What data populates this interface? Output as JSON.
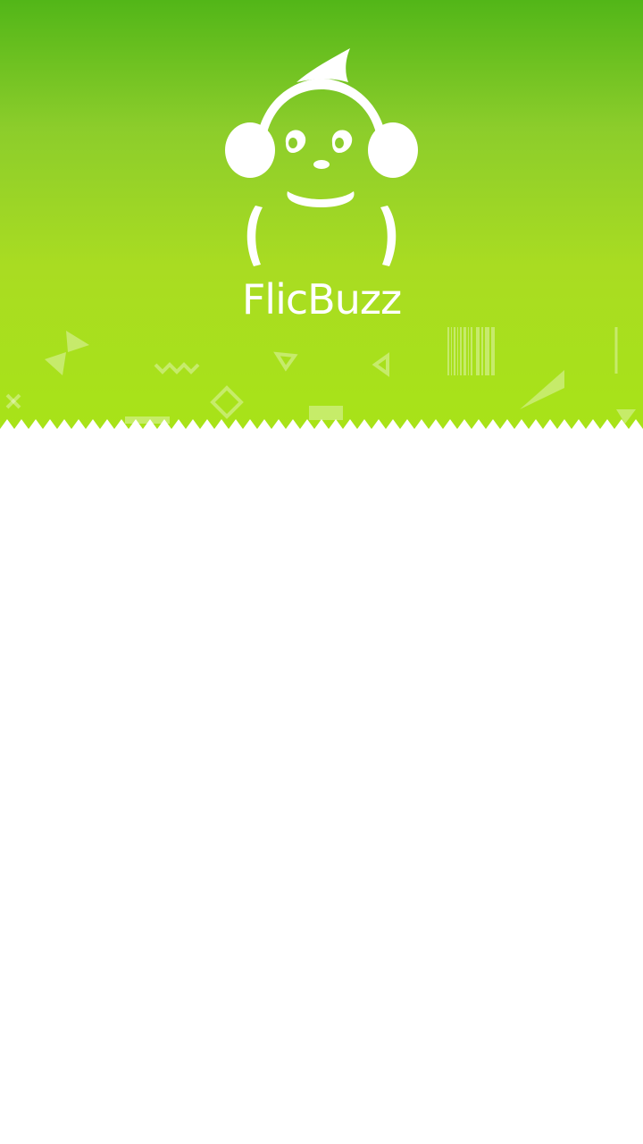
{
  "app": {
    "name": "FlicBuzz",
    "logo_icon": "headphone-mascot-icon"
  },
  "theme": {
    "gradient_top": "#52b618",
    "gradient_bottom": "#a8e318",
    "logo_color": "#ffffff",
    "background": "#ffffff"
  }
}
